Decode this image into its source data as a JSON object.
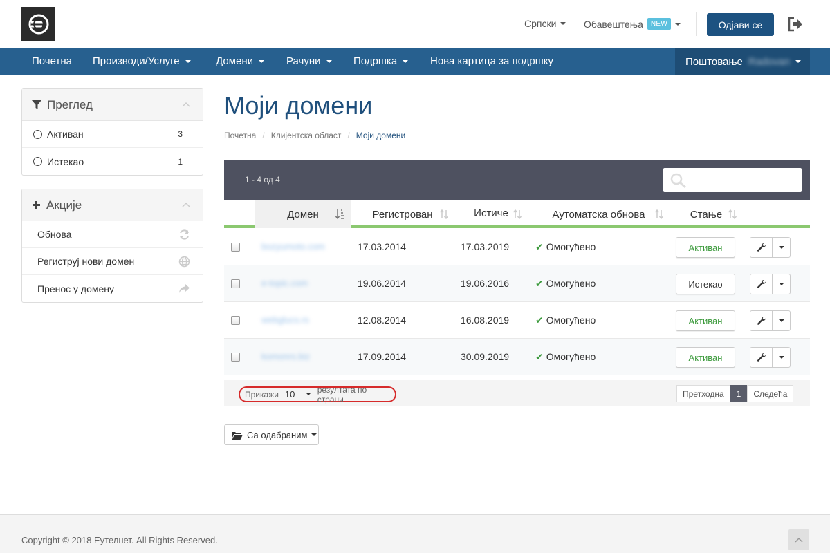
{
  "header": {
    "language_label": "Српски",
    "notifications_label": "Обавештења",
    "new_badge": "NEW",
    "logout_label": "Одјави се"
  },
  "nav": {
    "items": [
      {
        "label": "Почетна",
        "dropdown": false
      },
      {
        "label": "Производи/Услуге",
        "dropdown": true
      },
      {
        "label": "Домени",
        "dropdown": true
      },
      {
        "label": "Рачуни",
        "dropdown": true
      },
      {
        "label": "Подршка",
        "dropdown": true
      },
      {
        "label": "Нова картица за подршку",
        "dropdown": false
      }
    ],
    "greeting": "Поштовање",
    "greeting_name": "Radovan"
  },
  "sidebar": {
    "overview_title": "Преглед",
    "filters": [
      {
        "label": "Активан",
        "count": "3"
      },
      {
        "label": "Истекао",
        "count": "1"
      }
    ],
    "actions_title": "Акције",
    "actions": [
      {
        "label": "Обнова",
        "icon": "refresh-icon"
      },
      {
        "label": "Региструј нови домен",
        "icon": "globe-icon"
      },
      {
        "label": "Пренос у домену",
        "icon": "share-arrow-icon"
      }
    ]
  },
  "main": {
    "title": "Моји домени",
    "breadcrumb": [
      "Почетна",
      "Клијентска област",
      "Моји домени"
    ],
    "range_text": "1 - 4 од 4",
    "search_placeholder": "",
    "columns": [
      "Домен",
      "Регистрован",
      "Истиче",
      "Аутоматска обнова",
      "Стање"
    ],
    "rows": [
      {
        "domain": "bozyumoto.com",
        "registered": "17.03.2014",
        "expires": "17.03.2019",
        "auto_renew": "Омогућено",
        "status": "Активан",
        "status_color": "#3c9a3c"
      },
      {
        "domain": "e-topic.com",
        "registered": "19.06.2014",
        "expires": "19.06.2016",
        "auto_renew": "Омогућено",
        "status": "Истекао",
        "status_color": "#333333"
      },
      {
        "domain": "webglucs.rs",
        "registered": "12.08.2014",
        "expires": "16.08.2019",
        "auto_renew": "Омогућено",
        "status": "Активан",
        "status_color": "#3c9a3c"
      },
      {
        "domain": "komonrs.biz",
        "registered": "17.09.2014",
        "expires": "30.09.2019",
        "auto_renew": "Омогућено",
        "status": "Активан",
        "status_color": "#3c9a3c"
      }
    ],
    "per_page_prefix": "Прикажи",
    "per_page_value": "10",
    "per_page_suffix": "резултата по страни",
    "pager_prev": "Претходна",
    "pager_current": "1",
    "pager_next": "Следећа",
    "with_selected": "Са одабраним"
  },
  "footer": {
    "copyright": "Copyright © 2018 Еутелнет. All Rights Reserved."
  },
  "colors": {
    "brand_blue": "#27608f",
    "nav_dark": "#1e4d75",
    "title_blue": "#1f4f7c",
    "table_header_bar": "#4e5160",
    "accent_green": "#8bc870"
  }
}
